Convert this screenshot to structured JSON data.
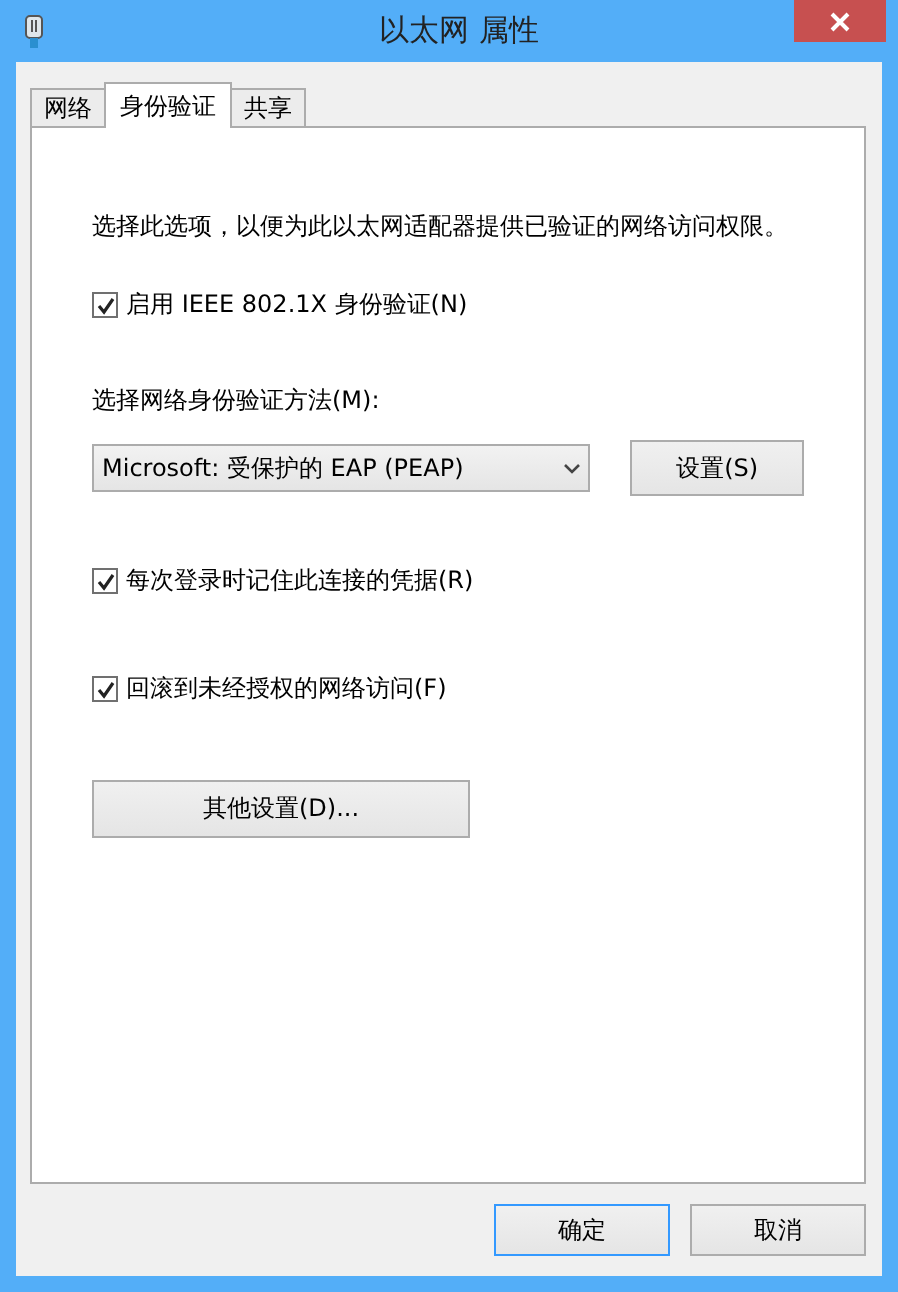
{
  "window": {
    "title": "以太网 属性"
  },
  "tabs": [
    {
      "label": "网络",
      "selected": false
    },
    {
      "label": "身份验证",
      "selected": true
    },
    {
      "label": "共享",
      "selected": false
    }
  ],
  "description": "选择此选项，以便为此以太网适配器提供已验证的网络访问权限。",
  "enable_checkbox": {
    "label": "启用 IEEE 802.1X 身份验证(N)",
    "checked": true
  },
  "method_label": "选择网络身份验证方法(M):",
  "method_select": {
    "value": "Microsoft: 受保护的 EAP (PEAP)"
  },
  "settings_button": "设置(S)",
  "options": [
    {
      "label": "每次登录时记住此连接的凭据(R)",
      "checked": true
    },
    {
      "label": "回滚到未经授权的网络访问(F)",
      "checked": true
    }
  ],
  "advanced_button": "其他设置(D)...",
  "buttons": [
    {
      "label": "确定",
      "default": true
    },
    {
      "label": "取消",
      "default": false
    }
  ]
}
